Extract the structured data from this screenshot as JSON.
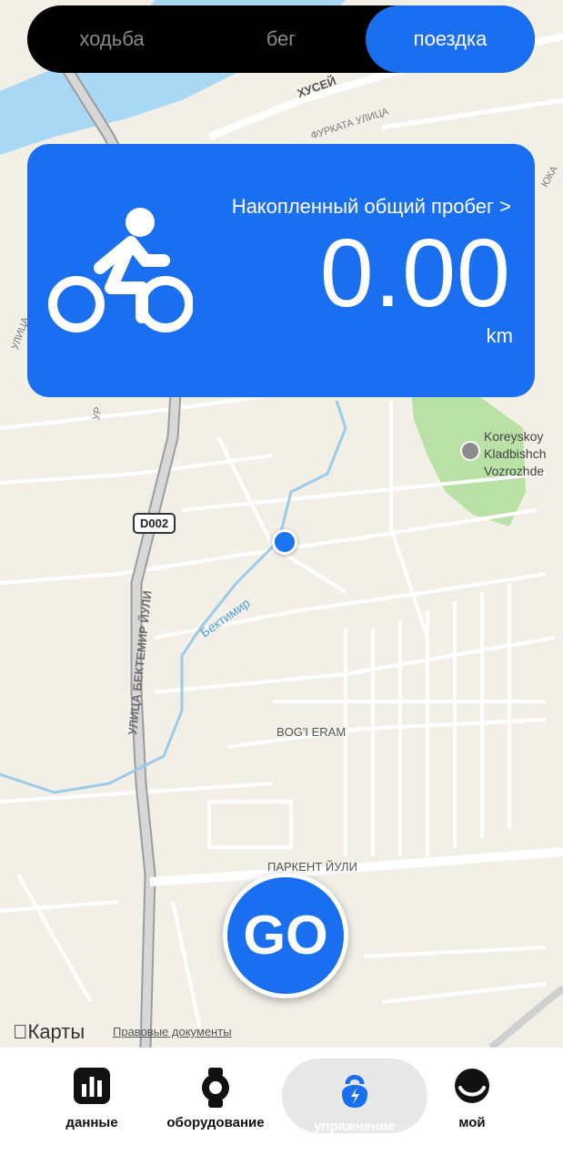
{
  "mode_tabs": [
    {
      "label": "ходьба",
      "active": false
    },
    {
      "label": "бег",
      "active": false
    },
    {
      "label": "поездка",
      "active": true
    }
  ],
  "stats": {
    "title": "Накопленный общий пробег >",
    "value": "0.00",
    "unit": "km",
    "icon": "cyclist-icon"
  },
  "map": {
    "labels": {
      "street_bektemir": "УЛИЦА БЕКТЕМИР ЙУЛИ",
      "road_code": "D002",
      "river": "Бектимир",
      "area": "BOG'I ERAM",
      "street_parkent": "ПАРКЕНТ ЙУЛИ",
      "street_furkat": "ФУРКАТА УЛИЦА",
      "street_husein": "ХУСЕЙ",
      "street_yuka": "ЮКА",
      "street_ulitsa_left": "УЛИЦА",
      "street_ur": "УР",
      "poi_line1": "Koreyskoy",
      "poi_line2": "Kladbishch",
      "poi_line3": "Vozrozhde"
    },
    "attribution": "Карты",
    "legal": "Правовые документы"
  },
  "go_button": "GO",
  "bottom_tabs": [
    {
      "label": "данные",
      "icon": "bar-chart-icon",
      "active": false
    },
    {
      "label": "оборудование",
      "icon": "watch-icon",
      "active": false
    },
    {
      "label": "упражнение",
      "icon": "kettlebell-icon",
      "active": true
    },
    {
      "label": "мой",
      "icon": "profile-icon",
      "active": false
    }
  ],
  "colors": {
    "accent": "#1a6ff0",
    "map_background": "#f2efe7",
    "water": "#a9d8f5",
    "park": "#b9e0a5"
  }
}
